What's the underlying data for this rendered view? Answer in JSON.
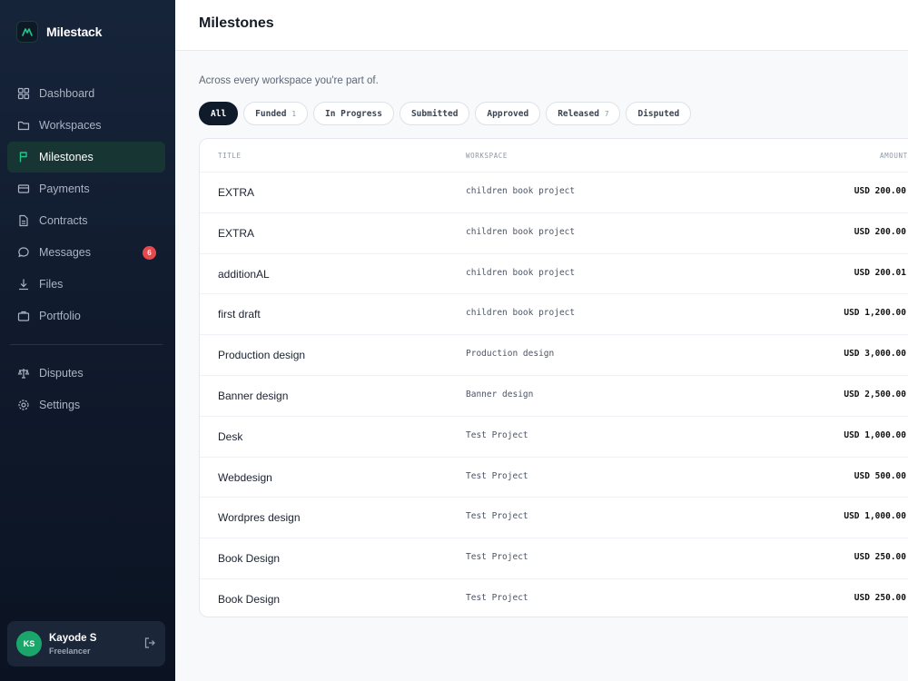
{
  "brand": {
    "name": "Milestack",
    "logo_icon": "milestack-logo-icon",
    "accent": "#1aa66a"
  },
  "sidebar": {
    "items": [
      {
        "label": "Dashboard",
        "icon": "grid-icon"
      },
      {
        "label": "Workspaces",
        "icon": "folder-icon"
      },
      {
        "label": "Milestones",
        "icon": "flag-icon",
        "active": true
      },
      {
        "label": "Payments",
        "icon": "card-icon"
      },
      {
        "label": "Contracts",
        "icon": "document-icon"
      },
      {
        "label": "Messages",
        "icon": "chat-icon",
        "badge": "6"
      },
      {
        "label": "Files",
        "icon": "download-icon"
      },
      {
        "label": "Portfolio",
        "icon": "briefcase-icon"
      }
    ],
    "secondary": [
      {
        "label": "Disputes",
        "icon": "scale-icon"
      },
      {
        "label": "Settings",
        "icon": "gear-icon"
      }
    ],
    "user": {
      "initials": "KS",
      "name": "Kayode S",
      "role": "Freelancer",
      "logout_icon": "logout-icon"
    }
  },
  "header": {
    "title": "Milestones"
  },
  "main": {
    "subtitle": "Across every workspace you're part of.",
    "filters": [
      {
        "label": "All",
        "active": true
      },
      {
        "label": "Funded",
        "count": "1"
      },
      {
        "label": "In Progress"
      },
      {
        "label": "Submitted"
      },
      {
        "label": "Approved"
      },
      {
        "label": "Released",
        "count": "7"
      },
      {
        "label": "Disputed"
      }
    ],
    "table": {
      "columns": [
        "TITLE",
        "WORKSPACE",
        "AMOUNT"
      ],
      "rows": [
        {
          "title": "EXTRA",
          "workspace": "children book project",
          "amount": "USD 200.00"
        },
        {
          "title": "EXTRA",
          "workspace": "children book project",
          "amount": "USD 200.00"
        },
        {
          "title": "additionAL",
          "workspace": "children book project",
          "amount": "USD 200.01"
        },
        {
          "title": "first draft",
          "workspace": "children book project",
          "amount": "USD 1,200.00"
        },
        {
          "title": "Production design",
          "workspace": "Production design",
          "amount": "USD 3,000.00"
        },
        {
          "title": "Banner design",
          "workspace": "Banner design",
          "amount": "USD 2,500.00"
        },
        {
          "title": "Desk",
          "workspace": "Test Project",
          "amount": "USD 1,000.00"
        },
        {
          "title": "Webdesign",
          "workspace": "Test Project",
          "amount": "USD 500.00"
        },
        {
          "title": "Wordpres design",
          "workspace": "Test Project",
          "amount": "USD 1,000.00"
        },
        {
          "title": "Book Design",
          "workspace": "Test Project",
          "amount": "USD 250.00"
        },
        {
          "title": "Book Design",
          "workspace": "Test Project",
          "amount": "USD 250.00"
        }
      ]
    }
  }
}
